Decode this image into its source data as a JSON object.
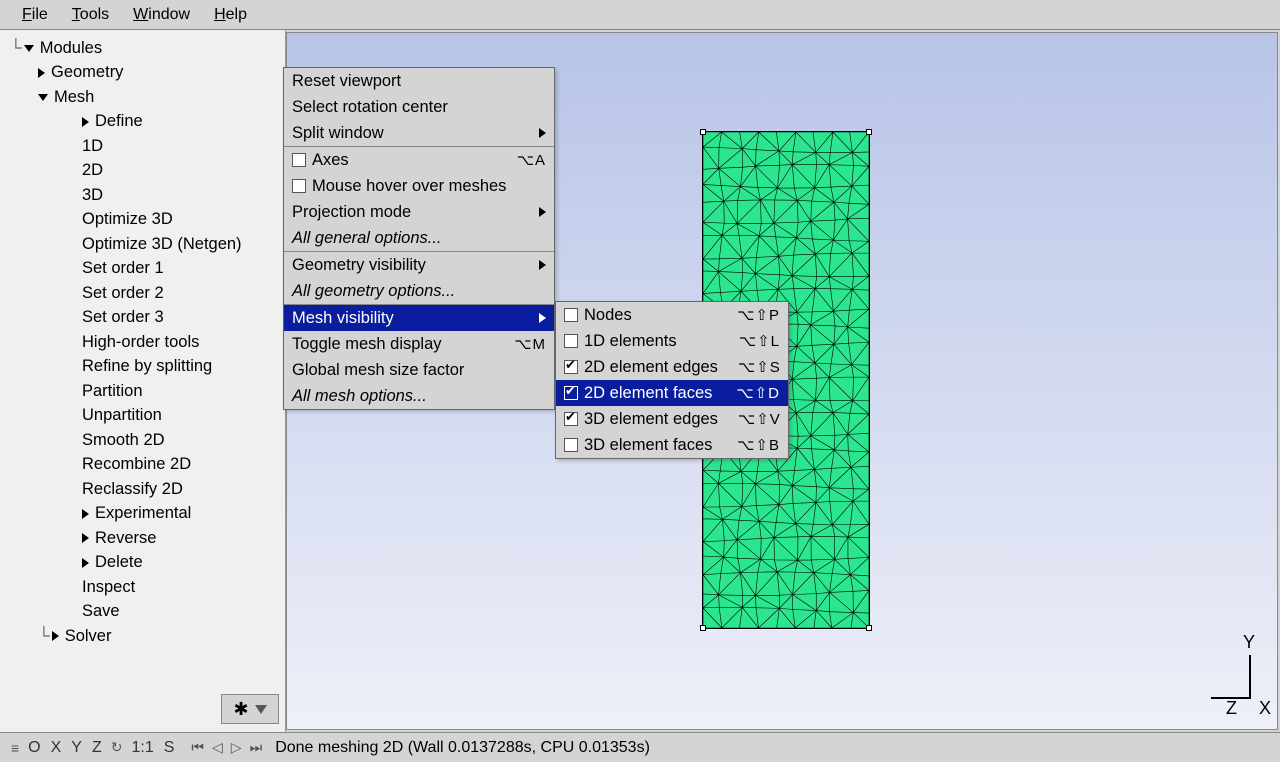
{
  "menubar": {
    "file": "File",
    "tools": "Tools",
    "window": "Window",
    "help": "Help"
  },
  "tree": {
    "modules": "Modules",
    "geometry": "Geometry",
    "mesh": "Mesh",
    "items": [
      "Define",
      "1D",
      "2D",
      "3D",
      "Optimize 3D",
      "Optimize 3D (Netgen)",
      "Set order 1",
      "Set order 2",
      "Set order 3",
      "High-order tools",
      "Refine by splitting",
      "Partition",
      "Unpartition",
      "Smooth 2D",
      "Recombine 2D",
      "Reclassify 2D",
      "Experimental",
      "Reverse",
      "Delete",
      "Inspect",
      "Save"
    ],
    "solver": "Solver"
  },
  "contextMenu1": {
    "reset": "Reset viewport",
    "selectRot": "Select rotation center",
    "split": "Split window",
    "axes": "Axes",
    "axesShortcut": "⌥A",
    "hover": "Mouse hover over meshes",
    "projection": "Projection mode",
    "allGeneral": "All general options...",
    "geomVis": "Geometry visibility",
    "allGeom": "All geometry options...",
    "meshVis": "Mesh visibility",
    "toggleMesh": "Toggle mesh display",
    "toggleMeshShortcut": "⌥M",
    "globalSize": "Global mesh size factor",
    "allMesh": "All mesh options..."
  },
  "contextMenu2": {
    "items": [
      {
        "label": "Nodes",
        "shortcut": "⌥⇧P",
        "checked": false,
        "hl": false
      },
      {
        "label": "1D elements",
        "shortcut": "⌥⇧L",
        "checked": false,
        "hl": false
      },
      {
        "label": "2D element edges",
        "shortcut": "⌥⇧S",
        "checked": true,
        "hl": false
      },
      {
        "label": "2D element faces",
        "shortcut": "⌥⇧D",
        "checked": true,
        "hl": true
      },
      {
        "label": "3D element edges",
        "shortcut": "⌥⇧V",
        "checked": true,
        "hl": false
      },
      {
        "label": "3D element faces",
        "shortcut": "⌥⇧B",
        "checked": false,
        "hl": false
      }
    ]
  },
  "axes": {
    "x": "X",
    "y": "Y",
    "z": "Z"
  },
  "statusbar": {
    "nav": [
      "O",
      "X",
      "Y",
      "Z"
    ],
    "ratio": "1:1",
    "mode": "S",
    "msg": "Done meshing 2D (Wall 0.0137288s, CPU 0.01353s)"
  }
}
